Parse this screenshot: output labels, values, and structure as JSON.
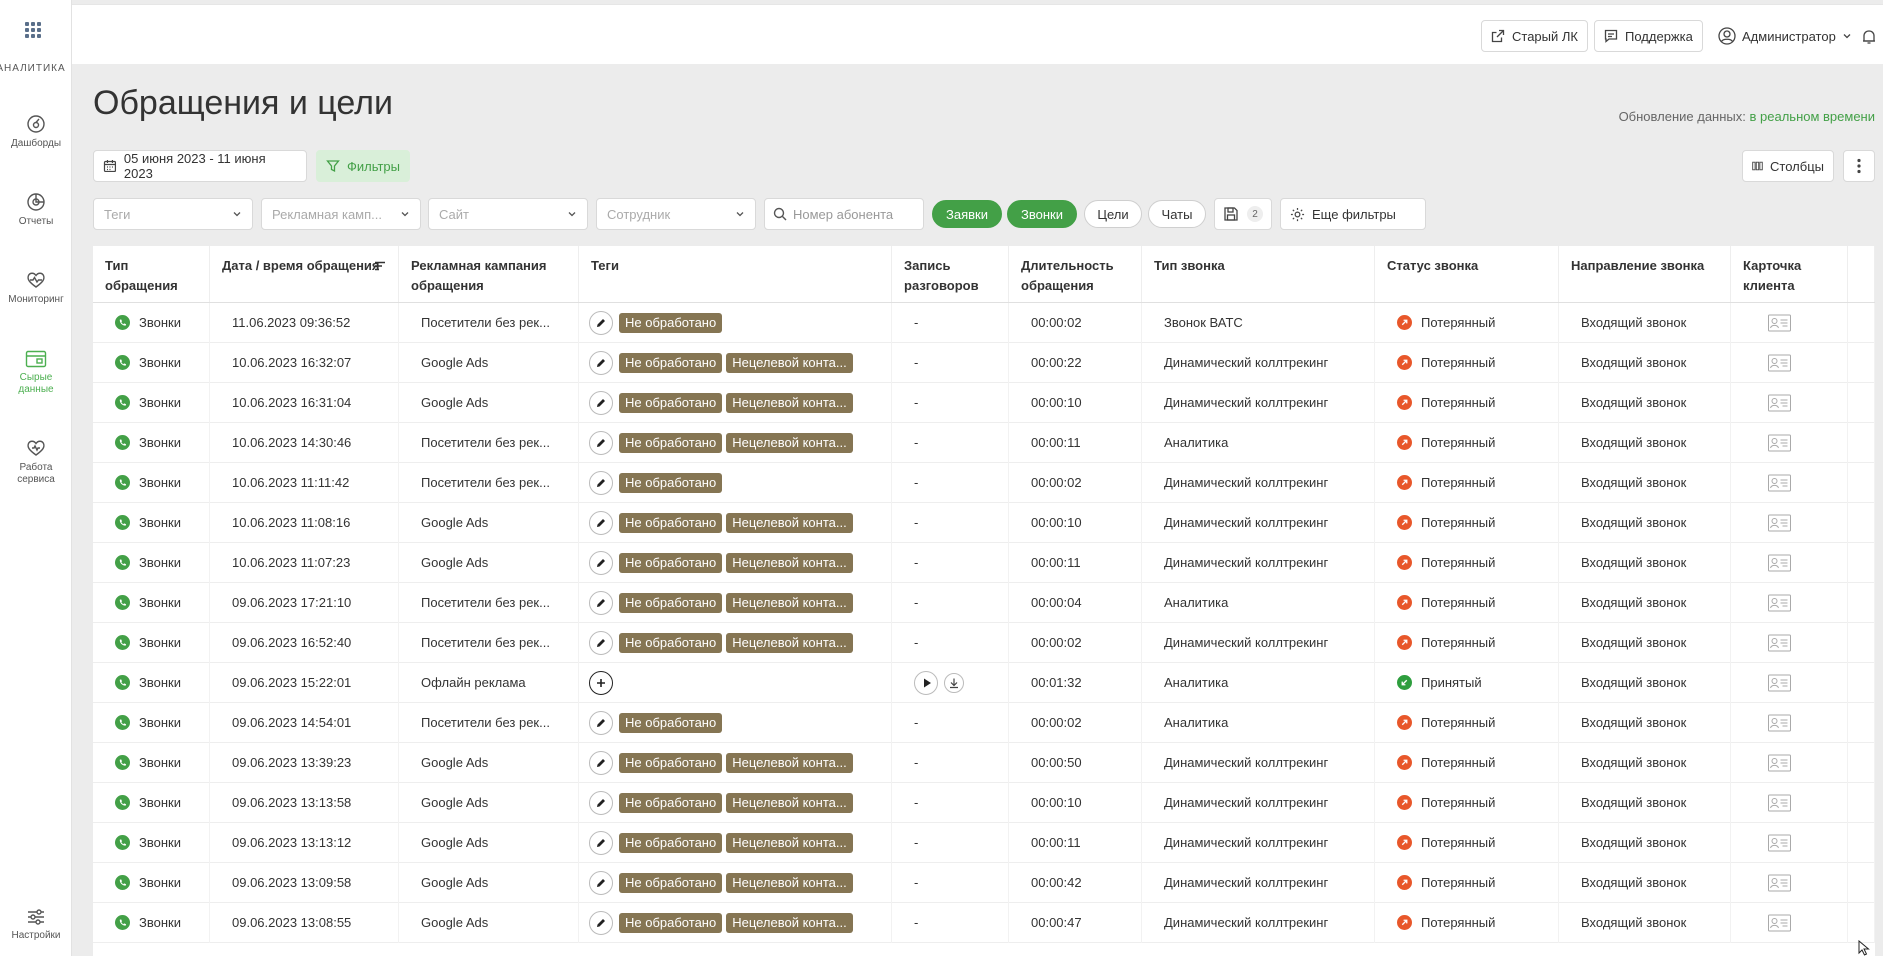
{
  "sidebar": {
    "brand": "АНАЛИТИКА",
    "items": [
      {
        "label": "Дашборды",
        "icon": "dashboard-icon"
      },
      {
        "label": "Отчеты",
        "icon": "reports-icon"
      },
      {
        "label": "Мониторинг",
        "icon": "monitoring-icon"
      },
      {
        "label": "Сырые данные",
        "icon": "raw-data-icon",
        "active": true
      },
      {
        "label": "Работа сервиса",
        "icon": "service-icon"
      },
      {
        "label": "Настройки",
        "icon": "settings-icon"
      }
    ]
  },
  "topbar": {
    "old_lk": "Старый ЛК",
    "support": "Поддержка",
    "user": "Администратор"
  },
  "header": {
    "title": "Обращения и цели",
    "update_label": "Обновление данных:",
    "update_value": "в реальном времени"
  },
  "toolbar": {
    "date_range": "05 июня 2023 - 11 июня 2023",
    "filters": "Фильтры",
    "columns": "Столбцы"
  },
  "filters": {
    "tags_placeholder": "Теги",
    "campaign_placeholder": "Рекламная камп...",
    "site_placeholder": "Сайт",
    "employee_placeholder": "Сотрудник",
    "phone_placeholder": "Номер абонента",
    "pills": [
      {
        "label": "Заявки",
        "on": true
      },
      {
        "label": "Звонки",
        "on": true
      },
      {
        "label": "Цели",
        "on": false
      },
      {
        "label": "Чаты",
        "on": false
      }
    ],
    "saved_count": "2",
    "more_filters": "Еще фильтры"
  },
  "table": {
    "columns": [
      "Тип обращения",
      "Дата / время обращения",
      "Рекламная кампания обращения",
      "Теги",
      "Запись разговоров",
      "Длительность обращения",
      "Тип звонка",
      "Статус звонка",
      "Направление звонка",
      "Карточка клиента"
    ],
    "rows": [
      {
        "type": "Звонки",
        "datetime": "11.06.2023 09:36:52",
        "campaign": "Посетители без рек...",
        "tags": [
          "Не обработано"
        ],
        "record": "-",
        "duration": "00:00:02",
        "call_type": "Звонок ВАТС",
        "status": "Потерянный",
        "status_kind": "lost",
        "direction": "Входящий звонок"
      },
      {
        "type": "Звонки",
        "datetime": "10.06.2023 16:32:07",
        "campaign": "Google Ads",
        "tags": [
          "Не обработано",
          "Нецелевой конта..."
        ],
        "record": "-",
        "duration": "00:00:22",
        "call_type": "Динамический коллтрекинг",
        "status": "Потерянный",
        "status_kind": "lost",
        "direction": "Входящий звонок"
      },
      {
        "type": "Звонки",
        "datetime": "10.06.2023 16:31:04",
        "campaign": "Google Ads",
        "tags": [
          "Не обработано",
          "Нецелевой конта..."
        ],
        "record": "-",
        "duration": "00:00:10",
        "call_type": "Динамический коллтрекинг",
        "status": "Потерянный",
        "status_kind": "lost",
        "direction": "Входящий звонок"
      },
      {
        "type": "Звонки",
        "datetime": "10.06.2023 14:30:46",
        "campaign": "Посетители без рек...",
        "tags": [
          "Не обработано",
          "Нецелевой конта..."
        ],
        "record": "-",
        "duration": "00:00:11",
        "call_type": "Аналитика",
        "status": "Потерянный",
        "status_kind": "lost",
        "direction": "Входящий звонок"
      },
      {
        "type": "Звонки",
        "datetime": "10.06.2023 11:11:42",
        "campaign": "Посетители без рек...",
        "tags": [
          "Не обработано"
        ],
        "record": "-",
        "duration": "00:00:02",
        "call_type": "Динамический коллтрекинг",
        "status": "Потерянный",
        "status_kind": "lost",
        "direction": "Входящий звонок"
      },
      {
        "type": "Звонки",
        "datetime": "10.06.2023 11:08:16",
        "campaign": "Google Ads",
        "tags": [
          "Не обработано",
          "Нецелевой конта..."
        ],
        "record": "-",
        "duration": "00:00:10",
        "call_type": "Динамический коллтрекинг",
        "status": "Потерянный",
        "status_kind": "lost",
        "direction": "Входящий звонок"
      },
      {
        "type": "Звонки",
        "datetime": "10.06.2023 11:07:23",
        "campaign": "Google Ads",
        "tags": [
          "Не обработано",
          "Нецелевой конта..."
        ],
        "record": "-",
        "duration": "00:00:11",
        "call_type": "Динамический коллтрекинг",
        "status": "Потерянный",
        "status_kind": "lost",
        "direction": "Входящий звонок"
      },
      {
        "type": "Звонки",
        "datetime": "09.06.2023 17:21:10",
        "campaign": "Посетители без рек...",
        "tags": [
          "Не обработано",
          "Нецелевой конта..."
        ],
        "record": "-",
        "duration": "00:00:04",
        "call_type": "Аналитика",
        "status": "Потерянный",
        "status_kind": "lost",
        "direction": "Входящий звонок"
      },
      {
        "type": "Звонки",
        "datetime": "09.06.2023 16:52:40",
        "campaign": "Посетители без рек...",
        "tags": [
          "Не обработано",
          "Нецелевой конта..."
        ],
        "record": "-",
        "duration": "00:00:02",
        "call_type": "Динамический коллтрекинг",
        "status": "Потерянный",
        "status_kind": "lost",
        "direction": "Входящий звонок"
      },
      {
        "type": "Звонки",
        "datetime": "09.06.2023 15:22:01",
        "campaign": "Офлайн реклама",
        "tags": [],
        "record": "play",
        "duration": "00:01:32",
        "call_type": "Аналитика",
        "status": "Принятый",
        "status_kind": "ok",
        "direction": "Входящий звонок"
      },
      {
        "type": "Звонки",
        "datetime": "09.06.2023 14:54:01",
        "campaign": "Посетители без рек...",
        "tags": [
          "Не обработано"
        ],
        "record": "-",
        "duration": "00:00:02",
        "call_type": "Аналитика",
        "status": "Потерянный",
        "status_kind": "lost",
        "direction": "Входящий звонок"
      },
      {
        "type": "Звонки",
        "datetime": "09.06.2023 13:39:23",
        "campaign": "Google Ads",
        "tags": [
          "Не обработано",
          "Нецелевой конта..."
        ],
        "record": "-",
        "duration": "00:00:50",
        "call_type": "Динамический коллтрекинг",
        "status": "Потерянный",
        "status_kind": "lost",
        "direction": "Входящий звонок"
      },
      {
        "type": "Звонки",
        "datetime": "09.06.2023 13:13:58",
        "campaign": "Google Ads",
        "tags": [
          "Не обработано",
          "Нецелевой конта..."
        ],
        "record": "-",
        "duration": "00:00:10",
        "call_type": "Динамический коллтрекинг",
        "status": "Потерянный",
        "status_kind": "lost",
        "direction": "Входящий звонок"
      },
      {
        "type": "Звонки",
        "datetime": "09.06.2023 13:13:12",
        "campaign": "Google Ads",
        "tags": [
          "Не обработано",
          "Нецелевой конта..."
        ],
        "record": "-",
        "duration": "00:00:11",
        "call_type": "Динамический коллтрекинг",
        "status": "Потерянный",
        "status_kind": "lost",
        "direction": "Входящий звонок"
      },
      {
        "type": "Звонки",
        "datetime": "09.06.2023 13:09:58",
        "campaign": "Google Ads",
        "tags": [
          "Не обработано",
          "Нецелевой конта..."
        ],
        "record": "-",
        "duration": "00:00:42",
        "call_type": "Динамический коллтрекинг",
        "status": "Потерянный",
        "status_kind": "lost",
        "direction": "Входящий звонок"
      },
      {
        "type": "Звонки",
        "datetime": "09.06.2023 13:08:55",
        "campaign": "Google Ads",
        "tags": [
          "Не обработано",
          "Нецелевой конта..."
        ],
        "record": "-",
        "duration": "00:00:47",
        "call_type": "Динамический коллтрекинг",
        "status": "Потерянный",
        "status_kind": "lost",
        "direction": "Входящий звонок"
      }
    ]
  },
  "colors": {
    "accent": "#43a047",
    "tag": "#857553",
    "lost": "#e8572a",
    "accepted": "#2e9e3e"
  }
}
